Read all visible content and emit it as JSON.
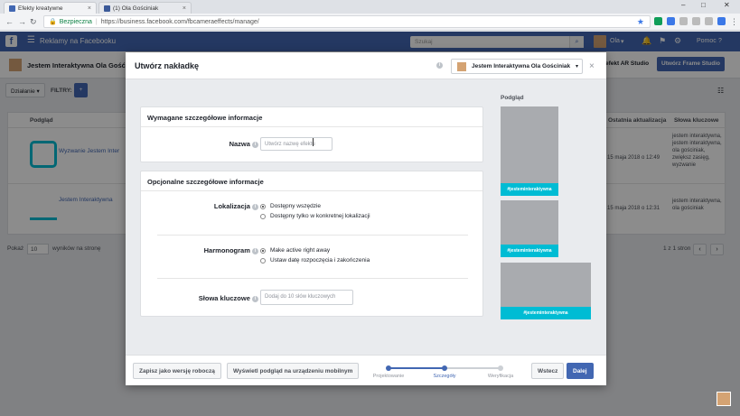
{
  "browser": {
    "tabs": [
      {
        "title": "Efekty kreatywne",
        "active": true
      },
      {
        "title": "(1) Ola Gościniak",
        "active": false
      }
    ],
    "secure_label": "Bezpieczna",
    "url": "https://business.facebook.com/fbcameraeffects/manage/"
  },
  "fb": {
    "logo": "f",
    "title": "Reklamy na Facebooku",
    "search_placeholder": "Szukaj",
    "user": "Ola",
    "help": "Pomoc"
  },
  "background": {
    "account": "Jestem Interaktywna Ola Gość...",
    "btn_studio": "efekt AR Studio",
    "btn_frame": "Utwórz Frame Studio",
    "filter_sort": "Działanie",
    "filter_label": "FILTRY:",
    "columns": [
      "Podgląd",
      "Ostatnia aktualizacja",
      "Słowa kluczowe"
    ],
    "rows": [
      {
        "name": "Wyzwanie Jestem Inter",
        "date": "15 maja 2018 o 12:49",
        "keywords": "jestem interaktywna, jestem interaktywna, ola gościniak, zwiększ zasięg, wyzwanie"
      },
      {
        "name": "Jestem Interaktywna",
        "date": "15 maja 2018 o 12:31",
        "keywords": "jestem interaktywna, ola gościniak"
      }
    ],
    "pager_show": "Pokaż",
    "pager_count": "10",
    "pager_suffix": "wyników na stronę",
    "pager_status": "1 z 1 stron"
  },
  "modal": {
    "title": "Utwórz nakładkę",
    "account": "Jestem Interaktywna Ola Gościniak",
    "required_section": "Wymagane szczegółowe informacje",
    "name_label": "Nazwa",
    "name_placeholder": "Utwórz nazwę efektu",
    "optional_section": "Opcjonalne szczegółowe informacje",
    "location_label": "Lokalizacja",
    "location_options": [
      "Dostępny wszędzie",
      "Dostępny tylko w konkretnej lokalizacji"
    ],
    "schedule_label": "Harmonogram",
    "schedule_options": [
      "Make active right away",
      "Ustaw datę rozpoczęcia i zakończenia"
    ],
    "keywords_label": "Słowa kluczowe",
    "keywords_placeholder": "Dodaj do 10 słów kluczowych",
    "preview_label": "Podgląd",
    "preview_tag": "#jesteminteraktywna",
    "footer": {
      "save_draft": "Zapisz jako wersję roboczą",
      "mobile_preview": "Wyświetl podgląd na urządzeniu mobilnym",
      "steps": [
        "Projektowanie",
        "Szczegóły",
        "Weryfikacja"
      ],
      "back": "Wstecz",
      "next": "Dalej"
    }
  },
  "colors": {
    "fb_blue": "#4267b2",
    "preview_bar": "#00bcd4",
    "preview_gray": "#a9abaf"
  }
}
